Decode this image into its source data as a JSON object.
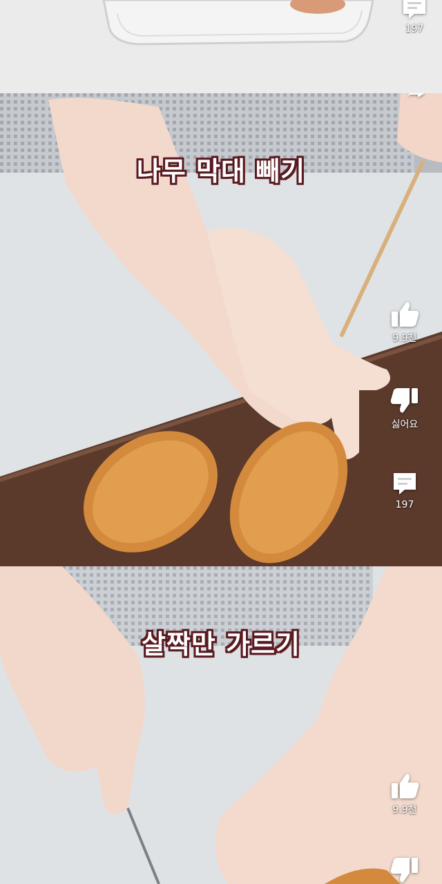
{
  "panels": [
    {
      "comments_count": "197"
    },
    {
      "caption": "나무 막대 빼기",
      "like_count": "9.9천",
      "dislike_label": "싫어요",
      "comments_count": "197"
    },
    {
      "caption": "살짝만 가르기",
      "like_count": "9.9천"
    }
  ],
  "icons": {
    "like": "thumbs-up-icon",
    "dislike": "thumbs-down-icon",
    "comments": "comment-icon",
    "share": "share-icon"
  },
  "colors": {
    "caption_text": "#ffffff",
    "caption_outline": "#5a1a20",
    "action_icon": "#ffffff"
  }
}
